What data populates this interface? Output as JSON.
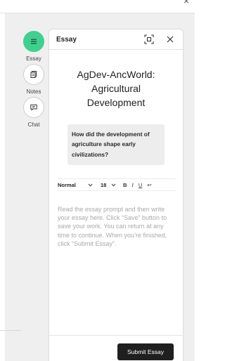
{
  "window": {
    "close_glyph": "×"
  },
  "rail": {
    "items": [
      {
        "label": "Essay",
        "icon": "essay-list-icon",
        "active": true
      },
      {
        "label": "Notes",
        "icon": "notes-icon",
        "active": false
      },
      {
        "label": "Chat",
        "icon": "chat-icon",
        "active": false
      }
    ]
  },
  "panel": {
    "title": "Essay",
    "doc_title": "AgDev-AncWorld: Agricultural Development",
    "prompt": "How did the development of agriculture shape early civilizations?",
    "toolbar": {
      "style_value": "Normal",
      "size_value": "18",
      "bold": "B",
      "italic": "I",
      "underline": "U",
      "clear_glyph": "↩"
    },
    "editor_placeholder": "Read the essay prompt and then write your essay here. Click “Save” button to save your work. You can return at any time to continue. When you’re finished, click “Submit Essay”.",
    "submit_label": "Submit Essay"
  },
  "colors": {
    "accent": "#3fd08f",
    "submit_bg": "#1f1f1f",
    "app_bg": "#efefef"
  }
}
